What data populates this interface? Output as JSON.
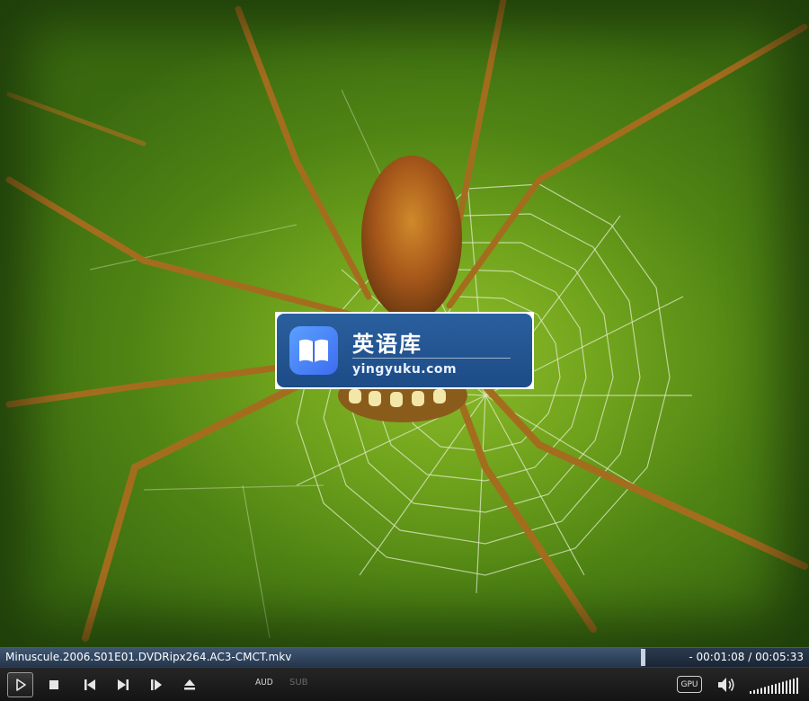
{
  "watermark": {
    "title": "英语库",
    "url": "yingyuku.com"
  },
  "info_bar": {
    "filename": "Minuscule.2006.S01E01.DVDRipx264.AC3-CMCT.mkv",
    "timecode": "- 00:01:08 / 00:05:33",
    "progress": 0.794
  },
  "controls": {
    "audio_label": "AUD",
    "subtitle_label": "SUB",
    "gpu_label": "GPU",
    "volume_level": 1.0,
    "icons": [
      "play-icon",
      "stop-icon",
      "previous-icon",
      "next-icon",
      "frame-step-icon",
      "eject-icon",
      "volume-icon"
    ]
  },
  "colors": {
    "seek_bar": "#24364c",
    "control_bar": "#1a1a1a",
    "watermark_bg": "#1d4c86",
    "logo_accent": "#4a86f5"
  }
}
